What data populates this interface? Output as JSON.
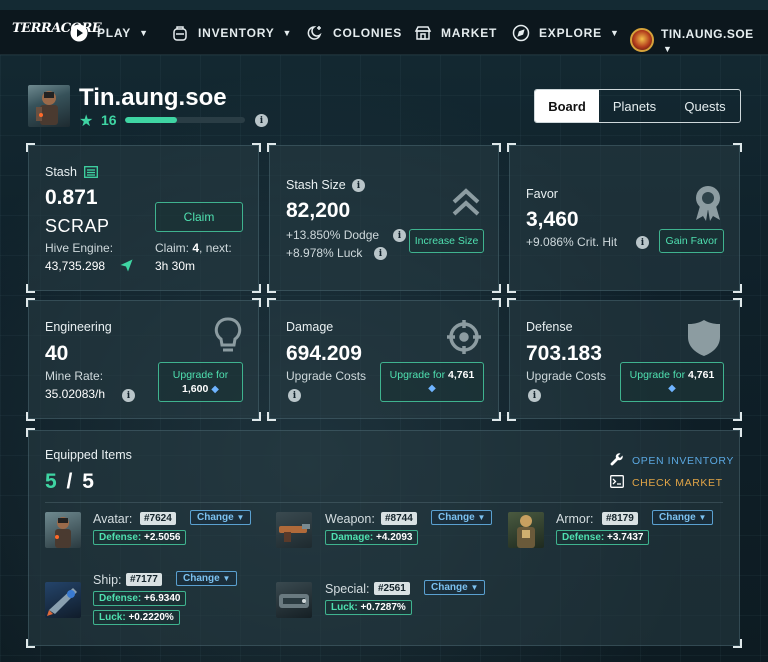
{
  "nav": {
    "logo": "TERRACORE",
    "items": [
      {
        "label": "PLAY",
        "icon": "play-icon",
        "caret": true
      },
      {
        "label": "INVENTORY",
        "icon": "backpack-icon",
        "caret": true
      },
      {
        "label": "COLONIES",
        "icon": "colonies-icon",
        "caret": false
      },
      {
        "label": "MARKET",
        "icon": "store-icon",
        "caret": false
      },
      {
        "label": "EXPLORE",
        "icon": "compass-icon",
        "caret": true
      }
    ],
    "user": "TIN.AUNG.SOE"
  },
  "profile": {
    "name": "Tin.aung.soe",
    "level": "16",
    "level_progress": 0.43
  },
  "tabs": [
    "Board",
    "Planets",
    "Quests"
  ],
  "cards": {
    "stash": {
      "label": "Stash",
      "value": "0.871",
      "unit": "SCRAP",
      "hive_label": "Hive Engine:",
      "hive_value": "43,735.298",
      "claim_button": "Claim",
      "claim_line1_a": "Claim: ",
      "claim_line1_b": "4",
      "claim_line1_c": ", next:",
      "claim_line2": "3h 30m"
    },
    "stash_size": {
      "label": "Stash Size",
      "value": "82,200",
      "line1": "+13.850% Dodge",
      "line2": "+8.978% Luck",
      "button": "Increase Size"
    },
    "favor": {
      "label": "Favor",
      "value": "3,460",
      "line1": "+9.086% Crit. Hit",
      "button": "Gain Favor"
    },
    "engineering": {
      "label": "Engineering",
      "value": "40",
      "rate_label": "Mine Rate:",
      "rate_value": "35.02083/h",
      "button_line1": "Upgrade for",
      "button_line2": "1,600"
    },
    "damage": {
      "label": "Damage",
      "value": "694.209",
      "costs": "Upgrade Costs",
      "button_a": "Upgrade for ",
      "button_b": "4,761"
    },
    "defense": {
      "label": "Defense",
      "value": "703.183",
      "costs": "Upgrade Costs",
      "button_a": "Upgrade for ",
      "button_b": "4,761"
    }
  },
  "equipped": {
    "title": "Equipped Items",
    "count": "5",
    "total": "5",
    "open_inventory": "OPEN INVENTORY",
    "check_market": "CHECK MARKET",
    "change_label": "Change",
    "items": {
      "avatar": {
        "label": "Avatar:",
        "id": "#7624",
        "stat": "Defense:",
        "value": "+2.5056"
      },
      "weapon": {
        "label": "Weapon:",
        "id": "#8744",
        "stat": "Damage:",
        "value": "+4.2093"
      },
      "armor": {
        "label": "Armor:",
        "id": "#8179",
        "stat": "Defense:",
        "value": "+3.7437"
      },
      "ship": {
        "label": "Ship:",
        "id": "#7177",
        "stat": "Defense:",
        "value": "+6.9340",
        "stat2": "Luck:",
        "value2": "+0.2220%"
      },
      "special": {
        "label": "Special:",
        "id": "#2561",
        "stat": "Luck:",
        "value": "+0.7287%"
      }
    }
  },
  "colors": {
    "accent": "#3fd5a3",
    "link_blue": "#5aa7e0",
    "link_orange": "#e0a447"
  }
}
